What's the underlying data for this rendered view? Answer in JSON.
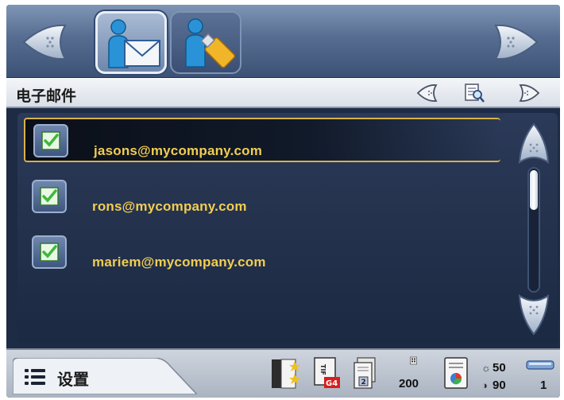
{
  "toolbar": {
    "prev_icon": "arrow-left-icon",
    "next_icon": "arrow-right-icon",
    "tabs": [
      {
        "icon": "user-email-icon",
        "active": true
      },
      {
        "icon": "user-usb-icon",
        "active": false
      }
    ]
  },
  "section": {
    "title": "电子邮件",
    "controls": [
      "arrow-left-icon",
      "preview-icon",
      "arrow-right-icon"
    ]
  },
  "email_list": {
    "items": [
      {
        "address": "jasons@mycompany.com",
        "checked": true,
        "selected": true
      },
      {
        "address": "rons@mycompany.com",
        "checked": true,
        "selected": false
      },
      {
        "address": "mariem@mycompany.com",
        "checked": true,
        "selected": false
      }
    ],
    "scroll_position": 0
  },
  "bottom": {
    "settings_label": "设置",
    "settings_icon": "list-icon",
    "status": {
      "dpi": "200",
      "brightness": "50",
      "contrast": "90",
      "count": "1"
    }
  },
  "colors": {
    "accent_text": "#f1cd52",
    "selection_border": "#d7b24a",
    "panel_bg": "#1d2b45",
    "check_green": "#3db83a"
  }
}
